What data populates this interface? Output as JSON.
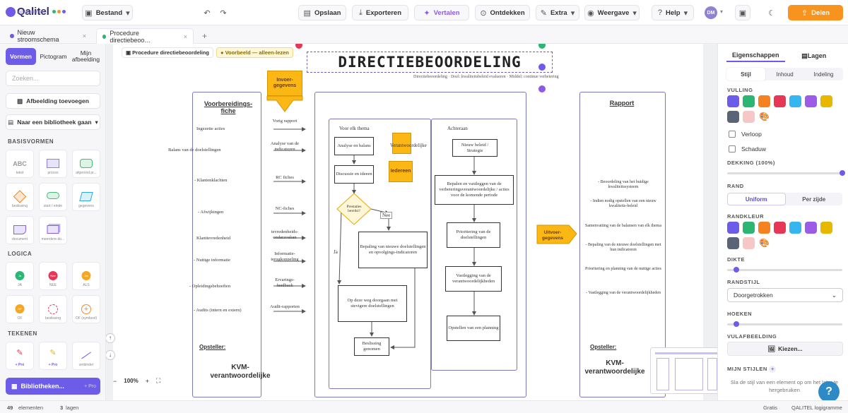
{
  "app": {
    "logo_text": "Qalitel",
    "logo_sub": "logigramme"
  },
  "toolbar": {
    "bestand": "Bestand",
    "opslaan": "Opslaan",
    "exporteren": "Exporteren",
    "vertalen": "Vertalen",
    "ontdekken": "Ontdekken",
    "extra": "Extra",
    "weergave": "Weergave",
    "help": "Help",
    "avatar": "DM",
    "delen": "Delen"
  },
  "tabs": [
    {
      "label": "Nieuw stroomschema",
      "color": "#6c5ce7"
    },
    {
      "label": "Procedure directiebeoo…",
      "color": "#2bb673"
    }
  ],
  "left_sidebar": {
    "tabs": [
      "Vormen",
      "Pictogram",
      "Mijn afbeelding"
    ],
    "search_placeholder": "Zoeken...",
    "add_image": "Afbeelding toevoegen",
    "library": "Naar een bibliotheek gaan",
    "sections": [
      "BASISVORMEN",
      "LOGICA",
      "TEKENEN"
    ],
    "basic_shapes": [
      "tekst",
      "proces",
      "afgerond pr...",
      "beslissing",
      "start / einde",
      "gegevens",
      "document",
      "meerdere do..."
    ],
    "logic_shapes": [
      "JA",
      "NEE",
      "ALS",
      "OF",
      "beslissing",
      "OF (symbool)"
    ],
    "draw_shapes": [
      "+ Pro",
      "+ Pro",
      "verbinder"
    ],
    "logic_icons": [
      "Ja",
      "Nee",
      "Als",
      "OF"
    ],
    "bottom_button": "Bibliotheken...",
    "bottom_badge": "+ Pro"
  },
  "canvas": {
    "breadcrumb": [
      "Procedure directiebeoordeling",
      "Voorbeeld — alleen-lezen"
    ],
    "title": "DIRECTIEBEOORDELING",
    "subtitle": "Directiebeoordeling · Doel: kwaliteitsbeleid evalueren · Middel: continue verbetering",
    "zoom": "100%",
    "lanes": {
      "left_title": "Voorbereidings-fiche",
      "middle_title": "Voor elk thema",
      "middle_right_title": "Achteraan",
      "right_title": "Rapport",
      "left_footer_label": "Opsteller:",
      "left_footer_role": "KVM-verantwoordelijke",
      "right_footer_label": "Opsteller:",
      "right_footer_role": "KVM-verantwoordelijke"
    },
    "inputs": [
      {
        "left": "Ingezette acties",
        "right": "Vorig rapport"
      },
      {
        "left": "Balans van de doelstellingen",
        "right": "Analyse van de indicatoren"
      },
      {
        "left": "- Klantenklachten",
        "right": "RC fiches"
      },
      {
        "left": "- Afwijkingen",
        "right": "NC-fiches"
      },
      {
        "left": "Klanttevredenheid",
        "right": "tevredenheids-onderzoeken"
      },
      {
        "left": "- Nuttige informatie",
        "right": "Informatie-terugkoppeling"
      },
      {
        "left": "- Opleidingsbehoeften",
        "right": "Ervarings-feedback"
      },
      {
        "left": "- Audits (intern en extern)",
        "right": "Audit-rapporten"
      }
    ],
    "process": {
      "analyse": "Analyse en balans",
      "discussie": "Discussie en ideeen",
      "decision": "Prestaties bereikt?",
      "nee": "Nee",
      "ja": "Ja",
      "bepaling": "Bepaling van nieuwe doelstellingen en opvolgings-indicatoren",
      "op_deze_weg": "Op deze weg doorgaan met stevigere doelstellingen",
      "beslissing": "Beslissing genomen",
      "verantwoordelijke": "Verantwoordelijke",
      "iedereen": "Iedereen",
      "invoer": "Invoer-gegevens",
      "uitvoer": "Uitvoer-gegevens"
    },
    "achteraan": [
      "Nieuw beleid / Strategie",
      "Bepalen en vastleggen van de verbeteringsverantwoordelijke / acties voor de komende periode",
      "Prioritering van de doelstellingen",
      "Vastlegging van de verantwoordelijkheden",
      "Opstellen van een planning"
    ],
    "rapport": [
      "- Beoordeling van het huidige kwaliteitssysteem",
      "- Indien nodig opstellen van een nieuw kwaliteits-beleid",
      "Samenvatting van de balansen van elk thema",
      "- Bepaling van de nieuwe doelstellingen met hun indicatoren",
      "Prioritering en planning van de nuttige acties",
      "- Vastlegging van de verantwoordelijkheden"
    ]
  },
  "right_sidebar": {
    "tabs": [
      "Eigenschappen",
      "Lagen"
    ],
    "subtabs": [
      "Stijl",
      "Inhoud",
      "Indeling"
    ],
    "vulling": "VULLING",
    "fill_colors": [
      "#6c5ce7",
      "#2bb673",
      "#f58220",
      "#e63757",
      "#36b6f0",
      "#9b5de5",
      "#e6b800",
      "#5a6478",
      "#f7c6c6"
    ],
    "verloop": "Verloop",
    "schaduw": "Schaduw",
    "dekking": "DEKKING (100%)",
    "dekking_value": 1.0,
    "rand": "RAND",
    "rand_options": [
      "Uniform",
      "Per zijde"
    ],
    "randkleur": "RANDKLEUR",
    "dikte": "DIKTE",
    "dikte_value": 0.08,
    "randstijl": "RANDSTIJL",
    "randstijl_value": "Doorgetrokken",
    "hoeken": "HOEKEN",
    "hoeken_value": 0.08,
    "vulafbeelding": "VULAFBEELDING",
    "kiezen": "Kiezen...",
    "mijn_stijlen": "MIJN STIJLEN",
    "stijlen_hint": "Sla de stijl van een element op om het later te hergebruiken"
  },
  "status": {
    "elements": "49",
    "elements_label": "elementen",
    "layers": "3",
    "layers_label": "lagen",
    "plan": "Gratis",
    "brand": "QALITEL logigramme"
  }
}
